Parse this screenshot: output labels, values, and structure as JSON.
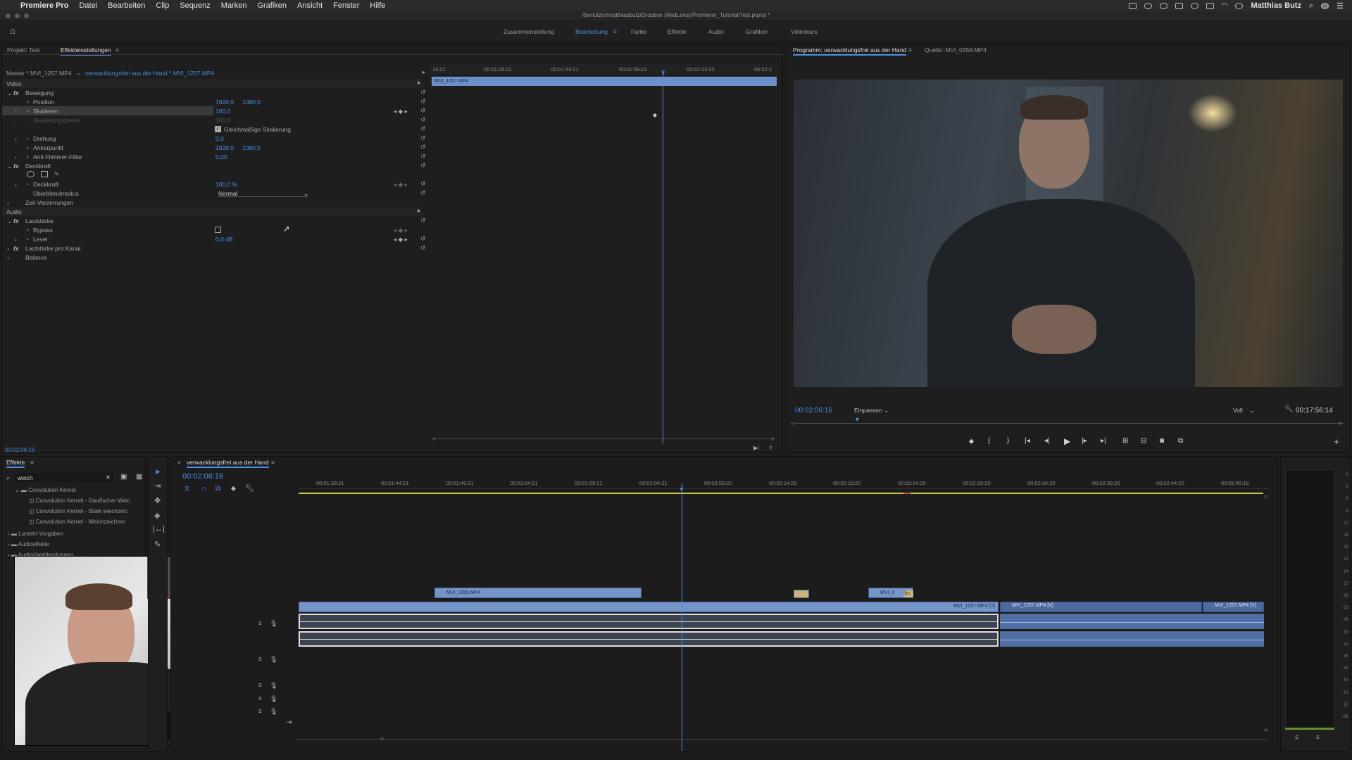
{
  "menubar": {
    "app": "Premiere Pro",
    "items": [
      "Datei",
      "Bearbeiten",
      "Clip",
      "Sequenz",
      "Marken",
      "Grafiken",
      "Ansicht",
      "Fenster",
      "Hilfe"
    ],
    "user": "Matthias Butz"
  },
  "title": "/Benutzer/matthiasbutz/Dropbox (RedLens)/Premiere/_Tutorial/Test.prproj *",
  "workspaces": {
    "tabs": [
      "Zusammenstellung",
      "Bearbeitung",
      "Farbe",
      "Effekte",
      "Audio",
      "Grafiken",
      "Videokurs"
    ],
    "active": "Bearbeitung"
  },
  "effectControls": {
    "tab_project": "Projekt: Test",
    "tab_effects": "Effekteinstellungen",
    "master": "Master * MVI_1257.MP4",
    "clip": "verwacklungsfrei aus der Hand * MVI_1257.MP4",
    "section_video": "Video",
    "bewegung": "Bewegung",
    "position": "Position",
    "position_x": "1920,0",
    "position_y": "1080,0",
    "skalieren": "Skalieren",
    "skalieren_val": "100,0",
    "skalierungsbreite": "Skalierungsbreite",
    "skalierungsbreite_val": "100,0",
    "gleichmaessig": "Gleichmäßige Skalierung",
    "drehung": "Drehung",
    "drehung_val": "0,0",
    "ankerpunkt": "Ankerpunkt",
    "anker_x": "1920,0",
    "anker_y": "1080,0",
    "antiflimmer": "Anti-Flimmer-Filter",
    "antiflimmer_val": "0,00",
    "deckkraft": "Deckkraft",
    "deckkraft_val": "100,0 %",
    "ueberblendmodus": "Überblendmodus",
    "blend_val": "Normal",
    "zeitverzerrung": "Zeit-Verzerrungen",
    "section_audio": "Audio",
    "lautstaerke": "Lautstärke",
    "bypass": "Bypass",
    "level": "Level",
    "level_val": "0,0 dB",
    "lautstaerke_kanal": "Lautstärke pro Kanal",
    "balance": "Balance",
    "timecode": "00:02:06:16",
    "ruler": [
      "14:22",
      "00:01:29:21",
      "00:01:44:21",
      "00:01:59:21",
      "00:02:14:20",
      "00:02:2"
    ],
    "mini_clip": "MVI_1257.MP4"
  },
  "program": {
    "tab_program": "Programm: verwacklungsfrei aus der Hand",
    "tab_source": "Quelle: MVI_0356.MP4",
    "timecode": "00:02:06:16",
    "fit": "Einpassen",
    "quality": "Voll",
    "duration": "00:17:56:14"
  },
  "effects": {
    "title": "Effekte",
    "search": "weich",
    "items": [
      "Convolution Kernel",
      "Convolution Kernel - Gaußscher Weic",
      "Convolution Kernel - Stark weichzeic",
      "Convolution Kernel - Weichzeichner",
      "Lumetri-Vorgaben",
      "Audioeffekte",
      "Audioüberblendungen"
    ]
  },
  "timeline": {
    "title": "verwacklungsfrei aus der Hand",
    "timecode": "00:02:06:16",
    "ruler": [
      "00:01:39:21",
      "00:01:44:21",
      "00:01:49:21",
      "00:01:54:21",
      "00:01:59:21",
      "00:02:04:21",
      "00:02:09:20",
      "00:02:14:20",
      "00:02:19:20",
      "00:02:24:20",
      "00:02:29:20",
      "00:02:34:20",
      "00:02:39:20",
      "00:02:44:20",
      "00:02:49:19"
    ],
    "clips": {
      "v2a": "MVI_0356.MP4",
      "v2b": "MVI_0",
      "v2c": "Sm",
      "v1a": "MVI_1257.MP4 [V]",
      "v1b": "MVI_1257.MP4 [V]",
      "v1c": "MVI_1257.MP4 [V]"
    }
  },
  "meter": {
    "scale": [
      "0",
      "-3",
      "-6",
      "-9",
      "-12",
      "-15",
      "-18",
      "-21",
      "-24",
      "-27",
      "-30",
      "-33",
      "-36",
      "-39",
      "-42",
      "-45",
      "-48",
      "-51",
      "-54",
      "-57",
      "-dB"
    ],
    "ch": [
      "S",
      "S"
    ]
  }
}
